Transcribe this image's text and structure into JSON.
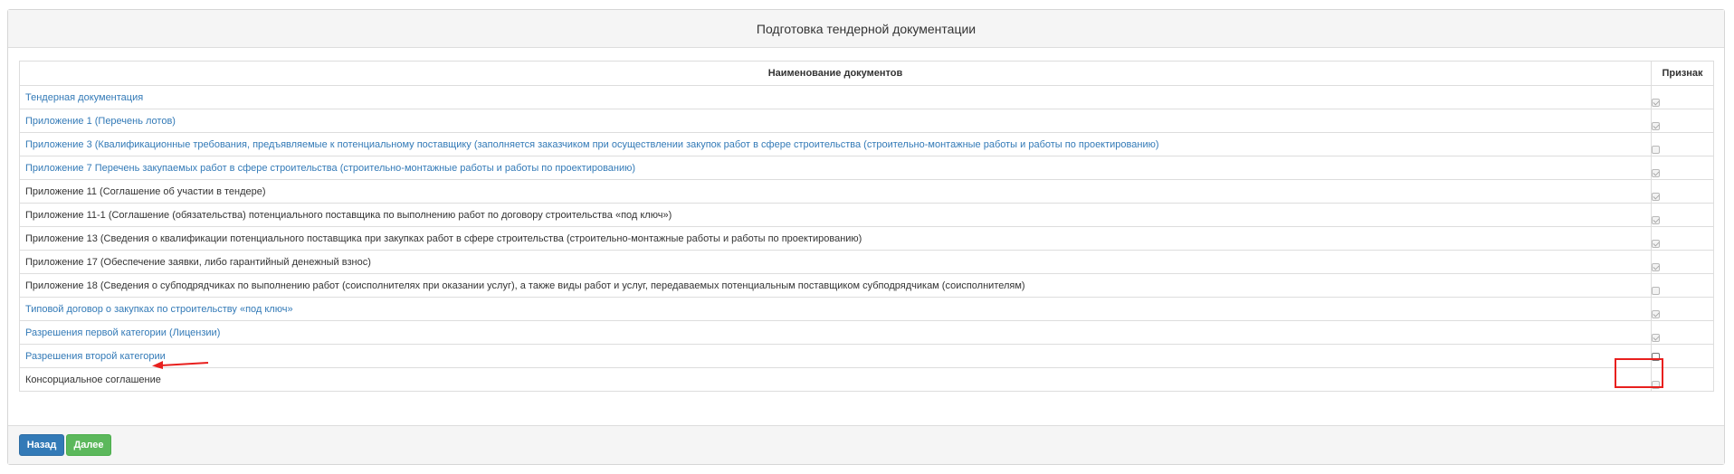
{
  "panel": {
    "title": "Подготовка тендерной документации"
  },
  "table": {
    "headers": {
      "name": "Наименование документов",
      "sign": "Признак"
    },
    "rows": [
      {
        "label": "Тендерная документация",
        "link": true,
        "checked": true,
        "enabled": false
      },
      {
        "label": "Приложение 1 (Перечень лотов)",
        "link": true,
        "checked": true,
        "enabled": false
      },
      {
        "label": "Приложение 3 (Квалификационные требования, предъявляемые к потенциальному поставщику (заполняется заказчиком при осуществлении закупок работ в сфере строительства (строительно-монтажные работы и работы по проектированию)",
        "link": true,
        "checked": false,
        "enabled": false
      },
      {
        "label": "Приложение 7 Перечень закупаемых работ в сфере строительства (строительно-монтажные работы и работы по проектированию)",
        "link": true,
        "checked": true,
        "enabled": false
      },
      {
        "label": "Приложение 11 (Соглашение об участии в тендере)",
        "link": false,
        "checked": true,
        "enabled": false
      },
      {
        "label": "Приложение 11-1 (Соглашение (обязательства) потенциального поставщика по выполнению работ по договору строительства «под ключ»)",
        "link": false,
        "checked": true,
        "enabled": false
      },
      {
        "label": "Приложение 13 (Сведения о квалификации потенциального поставщика при закупках работ в сфере строительства (строительно-монтажные работы и работы по проектированию)",
        "link": false,
        "checked": true,
        "enabled": false
      },
      {
        "label": "Приложение 17 (Обеспечение заявки, либо гарантийный денежный взнос)",
        "link": false,
        "checked": true,
        "enabled": false
      },
      {
        "label": "Приложение 18 (Сведения о субподрядчиках по выполнению работ (соисполнителях при оказании услуг), а также виды работ и услуг, передаваемых потенциальным поставщиком субподрядчикам (соисполнителям)",
        "link": false,
        "checked": false,
        "enabled": false
      },
      {
        "label": "Типовой договор о закупках по строительству «под ключ»",
        "link": true,
        "checked": true,
        "enabled": false
      },
      {
        "label": "Разрешения первой категории (Лицензии)",
        "link": true,
        "checked": true,
        "enabled": false
      },
      {
        "label": "Разрешения второй категории",
        "link": true,
        "checked": false,
        "enabled": true
      },
      {
        "label": "Консорциальное соглашение",
        "link": false,
        "checked": false,
        "enabled": false
      }
    ]
  },
  "footer": {
    "back_label": "Назад",
    "next_label": "Далее"
  },
  "colors": {
    "link": "#337ab7",
    "primary": "#337ab7",
    "success": "#5cb85c",
    "annotation": "#e8201e"
  }
}
